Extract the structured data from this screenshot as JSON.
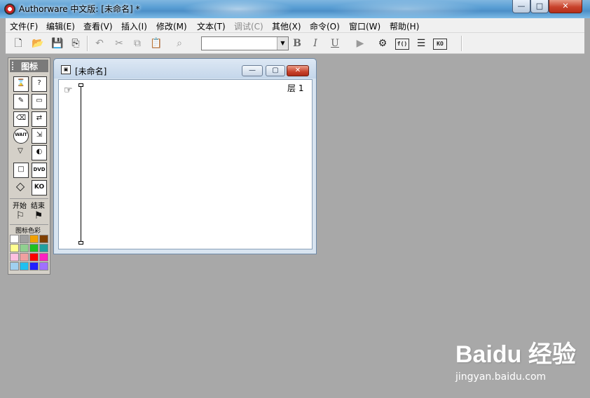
{
  "window": {
    "title": "Authorware 中文版: [未命名] *",
    "controls": {
      "minimize": "—",
      "maximize": "□",
      "close": "✕"
    }
  },
  "menubar": {
    "items": [
      {
        "label": "文件(F)",
        "enabled": true
      },
      {
        "label": "编辑(E)",
        "enabled": true
      },
      {
        "label": "查看(V)",
        "enabled": true
      },
      {
        "label": "插入(I)",
        "enabled": true
      },
      {
        "label": "修改(M)",
        "enabled": true
      },
      {
        "label": "文本(T)",
        "enabled": true
      },
      {
        "label": "调试(C)",
        "enabled": false
      },
      {
        "label": "其他(X)",
        "enabled": true
      },
      {
        "label": "命令(O)",
        "enabled": true
      },
      {
        "label": "窗口(W)",
        "enabled": true
      },
      {
        "label": "帮助(H)",
        "enabled": true
      }
    ]
  },
  "toolbar": {
    "font_select_value": "",
    "bold": "B",
    "italic": "I",
    "underline": "U",
    "func_label": "f()",
    "ko_label": "KO"
  },
  "palette": {
    "title": "图标",
    "icons": [
      "display-icon",
      "interaction-icon",
      "calculation-icon",
      "framework-icon",
      "erase-icon",
      "navigate-icon",
      "wait-icon",
      "map-icon",
      "decision-icon",
      "video-icon",
      "group-icon",
      "sound-icon",
      "interaction-diamond-icon",
      "knowledge-object-icon"
    ],
    "wait_label": "WAIT",
    "dvd_label": "DVD",
    "ko_label": "KO",
    "start_label": "开始",
    "end_label": "结束",
    "color_label": "图标色彩",
    "colors": [
      "#ffffff",
      "#a0a0a0",
      "#f0a000",
      "#804000",
      "#ffff90",
      "#90d090",
      "#20c020",
      "#20a0a0",
      "#ffc0e0",
      "#f0a0a0",
      "#ff0000",
      "#ff20c0",
      "#a0d0f0",
      "#20c0f0",
      "#2020ff",
      "#a070ff"
    ]
  },
  "design_window": {
    "title": "[未命名]",
    "level": "层 1"
  },
  "watermark": {
    "logo": "Baidu 经验",
    "url": "jingyan.baidu.com"
  }
}
